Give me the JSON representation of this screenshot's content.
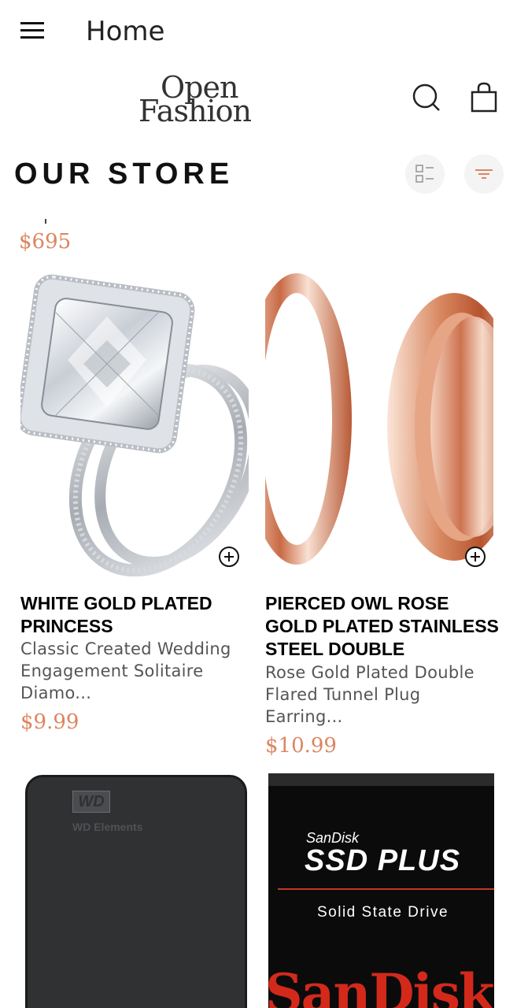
{
  "appbar": {
    "title": "Home",
    "menu_icon": "menu-icon"
  },
  "brand": {
    "logo_line1": "Open",
    "logo_line2": "Fashion"
  },
  "actions": {
    "search_icon": "search-icon",
    "cart_icon": "shopping-bag-icon"
  },
  "store": {
    "title": "OUR STORE",
    "view_icon": "list-view-icon",
    "filter_icon": "filter-icon"
  },
  "colors": {
    "accent": "#dd8560",
    "text": "#000000",
    "muted": "#555555"
  },
  "products": {
    "previous_price": "$695",
    "items": [
      {
        "title": "WHITE GOLD PLATED PRINCESS",
        "description": "Classic Created Wedding Engagement Solitaire Diamo...",
        "price": "$9.99",
        "image": "diamond-ring-image"
      },
      {
        "title": "PIERCED OWL ROSE GOLD PLATED STAINLESS STEEL DOUBLE",
        "description": "Rose Gold Plated Double Flared Tunnel Plug Earring...",
        "price": "$10.99",
        "image": "rose-gold-tunnel-image"
      },
      {
        "image": "wd-hard-drive-image",
        "image_text": "WD Elements",
        "logo_text": "WD"
      },
      {
        "image": "sandisk-ssd-image",
        "brand_small": "SanDisk",
        "product_line": "SSD PLUS",
        "subtitle": "Solid State Drive",
        "brand_big": "SanDisk"
      }
    ]
  }
}
